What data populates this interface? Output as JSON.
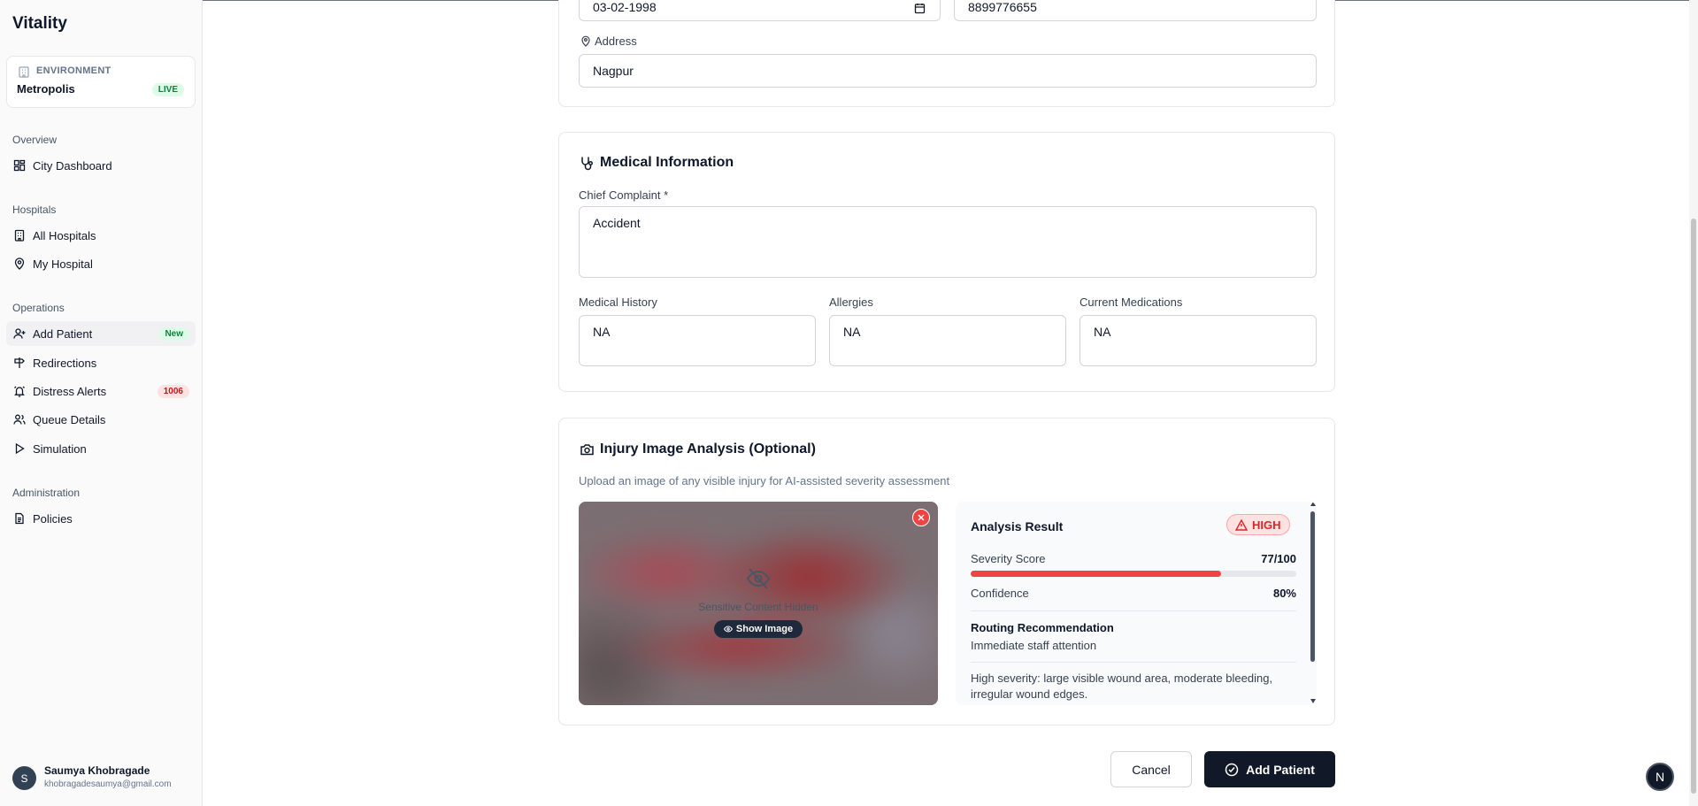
{
  "app": {
    "name": "Vitality"
  },
  "environment": {
    "label": "ENVIRONMENT",
    "name": "Metropolis",
    "status": "LIVE"
  },
  "nav": {
    "overview": {
      "title": "Overview",
      "items": [
        {
          "label": "City Dashboard"
        }
      ]
    },
    "hospitals": {
      "title": "Hospitals",
      "items": [
        {
          "label": "All Hospitals"
        },
        {
          "label": "My Hospital"
        }
      ]
    },
    "operations": {
      "title": "Operations",
      "items": [
        {
          "label": "Add Patient",
          "badge": "New"
        },
        {
          "label": "Redirections"
        },
        {
          "label": "Distress Alerts",
          "badge": "1006"
        },
        {
          "label": "Queue Details"
        },
        {
          "label": "Simulation"
        }
      ]
    },
    "administration": {
      "title": "Administration",
      "items": [
        {
          "label": "Policies"
        }
      ]
    }
  },
  "user": {
    "initial": "S",
    "name": "Saumya Khobragade",
    "email": "khobragadesaumya@gmail.com"
  },
  "patient": {
    "dob": "03-02-1998",
    "phone": "8899776655",
    "address_label": "Address",
    "address": "Nagpur"
  },
  "medical": {
    "title": "Medical Information",
    "chief_complaint_label": "Chief Complaint *",
    "chief_complaint": "Accident",
    "history_label": "Medical History",
    "history": "NA",
    "allergies_label": "Allergies",
    "allergies": "NA",
    "medications_label": "Current Medications",
    "medications": "NA"
  },
  "injury": {
    "title": "Injury Image Analysis (Optional)",
    "subtitle": "Upload an image of any visible injury for AI-assisted severity assessment",
    "hidden_text": "Sensitive Content Hidden",
    "show_button": "Show Image",
    "result": {
      "title": "Analysis Result",
      "level": "HIGH",
      "severity_label": "Severity Score",
      "severity_value": "77/100",
      "severity_fraction": 0.77,
      "confidence_label": "Confidence",
      "confidence_value": "80%",
      "routing_label": "Routing Recommendation",
      "routing_value": "Immediate staff attention",
      "note": "High severity: large visible wound area, moderate bleeding, irregular wound edges."
    }
  },
  "actions": {
    "cancel": "Cancel",
    "submit": "Add Patient"
  },
  "fab": {
    "letter": "N"
  },
  "colors": {
    "accent": "#0f172a",
    "danger": "#ef4444",
    "success": "#15803d"
  }
}
